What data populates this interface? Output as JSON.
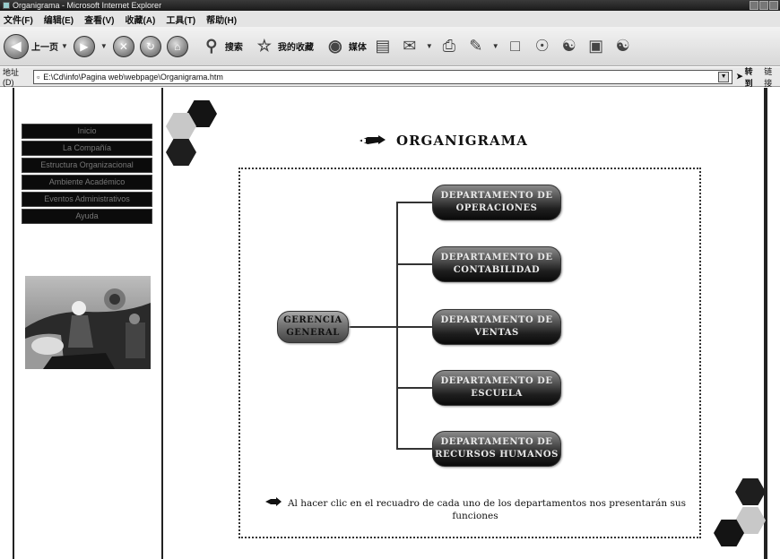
{
  "window": {
    "title": "Organigrama - Microsoft Internet Explorer"
  },
  "menubar": {
    "items": [
      "文件(F)",
      "编辑(E)",
      "查看(V)",
      "收藏(A)",
      "工具(T)",
      "帮助(H)"
    ]
  },
  "toolbar": {
    "back_label": "上一页",
    "search_label": "搜索",
    "favorites_label": "我的收藏",
    "media_label": "媒体"
  },
  "addressbar": {
    "label": "地址(D)",
    "value": "E:\\Cd\\info\\Pagina web\\webpage\\Organigrama.htm",
    "go_label": "转到",
    "links_label": "链接"
  },
  "nav": {
    "items": [
      "Inicio",
      "La Compañía",
      "Estructura Organizacional",
      "Ambiente Académico",
      "Eventos Administrativos",
      "Ayuda"
    ]
  },
  "page": {
    "title": "ORGANIGRAMA",
    "root_node": [
      "GERENCIA",
      "GENERAL"
    ],
    "departments": [
      [
        "DEPARTAMENTO DE",
        "OPERACIONES"
      ],
      [
        "DEPARTAMENTO DE",
        "CONTABILIDAD"
      ],
      [
        "DEPARTAMENTO DE",
        "VENTAS"
      ],
      [
        "DEPARTAMENTO DE",
        "ESCUELA"
      ],
      [
        "DEPARTAMENTO DE",
        "RECURSOS HUMANOS"
      ]
    ],
    "footnote": "Al hacer clic en el recuadro de cada uno de los departamentos nos presentarán sus funciones"
  },
  "colors": {
    "nav_bg": "#0b0b0b",
    "hex_dark": "#141414",
    "hex_light": "#c8c8c8",
    "node_dark": "#1e1e1e"
  }
}
